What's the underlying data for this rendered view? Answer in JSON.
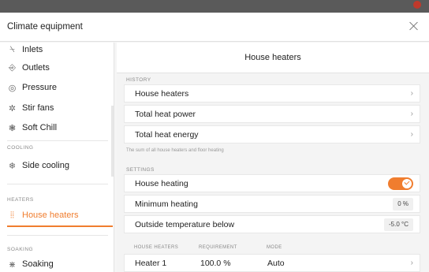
{
  "window": {
    "title": "Climate equipment"
  },
  "sidebar": {
    "items_top": [
      {
        "label": "Inlets",
        "icon": "inlet-icon"
      },
      {
        "label": "Outlets",
        "icon": "outlet-icon"
      },
      {
        "label": "Pressure",
        "icon": "pressure-icon"
      },
      {
        "label": "Stir fans",
        "icon": "fan-icon"
      },
      {
        "label": "Soft Chill",
        "icon": "soft-chill-icon"
      }
    ],
    "cooling": {
      "section": "COOLING",
      "items": [
        {
          "label": "Side cooling",
          "icon": "side-cooling-icon"
        }
      ]
    },
    "heaters": {
      "section": "HEATERS",
      "items": [
        {
          "label": "House heaters",
          "icon": "heater-icon",
          "active": true
        }
      ]
    },
    "soaking": {
      "section": "SOAKING",
      "items": [
        {
          "label": "Soaking",
          "icon": "soaking-icon"
        }
      ]
    }
  },
  "main": {
    "header": "House heaters",
    "history": {
      "label": "HISTORY",
      "rows": [
        "House heaters",
        "Total heat power",
        "Total heat energy"
      ],
      "note": "The sum of all house heaters and floor heating"
    },
    "settings": {
      "label": "SETTINGS",
      "house_heating": {
        "label": "House heating",
        "enabled": true
      },
      "minimum_heating": {
        "label": "Minimum heating",
        "value": "0 %"
      },
      "outside_temp": {
        "label": "Outside temperature below",
        "value": "-5.0 °C"
      }
    },
    "table": {
      "headers": [
        "HOUSE HEATERS",
        "REQUIREMENT",
        "MODE"
      ],
      "rows": [
        {
          "name": "Heater 1",
          "requirement": "100.0 %",
          "mode": "Auto"
        }
      ]
    }
  },
  "colors": {
    "accent": "#f07d2e"
  }
}
